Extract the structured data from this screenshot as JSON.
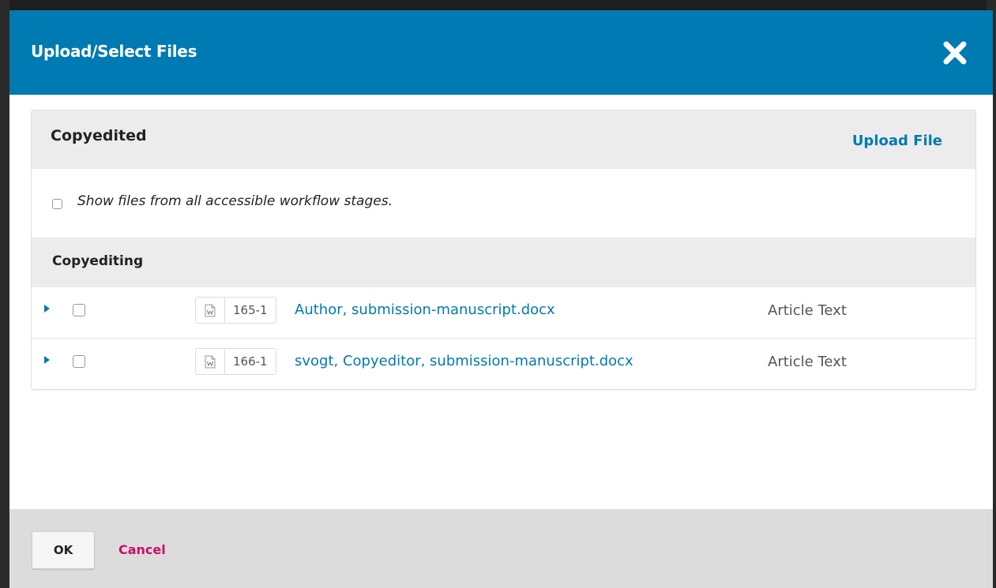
{
  "modal": {
    "title": "Upload/Select Files",
    "close_icon": "close-x-icon"
  },
  "panel": {
    "title": "Copyedited",
    "upload_label": "Upload File"
  },
  "filter": {
    "label": "Show files from all accessible workflow stages.",
    "checked": false
  },
  "group": {
    "title": "Copyediting"
  },
  "files": [
    {
      "icon": "word-document-icon",
      "id": "165-1",
      "name": "Author, submission-manuscript.docx",
      "genre": "Article Text",
      "checked": false
    },
    {
      "icon": "word-document-icon",
      "id": "166-1",
      "name": "svogt, Copyeditor, submission-manuscript.docx",
      "genre": "Article Text",
      "checked": false
    }
  ],
  "footer": {
    "ok_label": "OK",
    "cancel_label": "Cancel"
  },
  "colors": {
    "header_bg": "#007ab2",
    "link": "#007ab2",
    "cancel": "#d00a6c"
  }
}
